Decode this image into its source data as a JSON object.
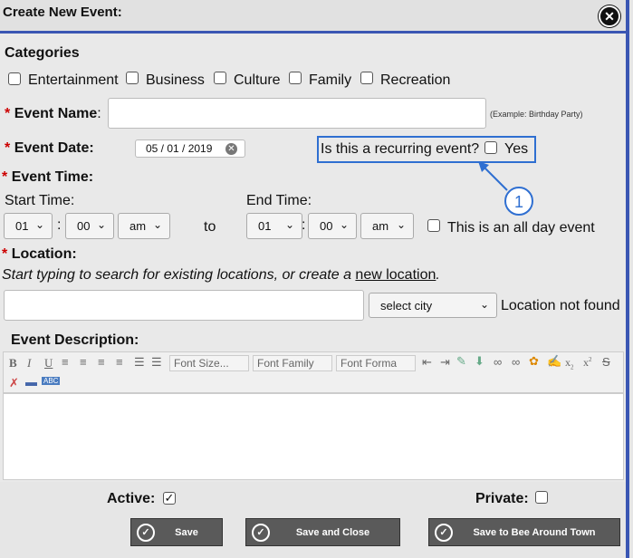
{
  "window": {
    "title": "Create New Event:"
  },
  "categories": {
    "heading": "Categories",
    "items": [
      "Entertainment",
      "Business",
      "Culture",
      "Family",
      "Recreation"
    ]
  },
  "event_name": {
    "label": "Event Name",
    "colon": ":",
    "value": "",
    "example": "(Example: Birthday Party)"
  },
  "event_date": {
    "label": "Event Date:",
    "value": "05 / 01 / 2019",
    "recurring_question": "Is this a recurring event?",
    "yes_label": "Yes"
  },
  "event_time": {
    "label": "Event Time:",
    "start_label": "Start Time:",
    "end_label": "End Time:",
    "start": {
      "hour": "01",
      "minute": "00",
      "ampm": "am"
    },
    "end": {
      "hour": "01",
      "minute": "00",
      "ampm": "am"
    },
    "to": "to",
    "all_day": "This is an all day event"
  },
  "location": {
    "label": "Location:",
    "hint_prefix": "Start typing to search for existing locations, or create a ",
    "hint_link": "new location",
    "hint_suffix": ".",
    "value": "",
    "city_select": "select city",
    "not_found": "Location not found"
  },
  "description": {
    "label": "Event Description:",
    "font_size": "Font Size...",
    "font_family": "Font Family",
    "font_format": "Font Forma",
    "b": "B",
    "i": "I",
    "u": "U",
    "abc": "ABC",
    "sub": "x",
    "sub_n": "2",
    "sup": "x",
    "sup_n": "2"
  },
  "flags": {
    "active": "Active:",
    "active_checked": true,
    "private": "Private:",
    "private_checked": false
  },
  "buttons": {
    "save": "Save",
    "save_close": "Save and Close",
    "save_bat": "Save to Bee Around Town"
  },
  "annotation": {
    "callout": "1"
  },
  "colors": {
    "accent": "#3a56b3",
    "highlight": "#2f6fd1",
    "required": "#cc0000",
    "button": "#5a5a5a"
  }
}
